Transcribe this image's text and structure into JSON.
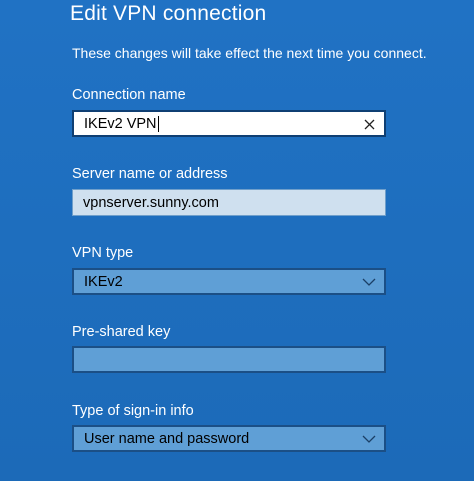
{
  "dialog": {
    "title": "Edit VPN connection",
    "subtitle": "These changes will take effect the next time you connect."
  },
  "connection_name": {
    "label": "Connection name",
    "value": "IKEv2 VPN",
    "clear_icon": "close-icon"
  },
  "server": {
    "label": "Server name or address",
    "value": "vpnserver.sunny.com"
  },
  "vpn_type": {
    "label": "VPN type",
    "selected": "IKEv2",
    "icon": "chevron-down-icon"
  },
  "preshared_key": {
    "label": "Pre-shared key",
    "value": ""
  },
  "signin_type": {
    "label": "Type of sign-in info",
    "selected": "User name and password",
    "icon": "chevron-down-icon"
  },
  "colors": {
    "background": "#1f6fbf",
    "field_active_bg": "#ffffff",
    "field_disabled_bg": "#cfe0ef",
    "select_bg": "#5f9fd6",
    "border_dark": "#1b4f86"
  }
}
